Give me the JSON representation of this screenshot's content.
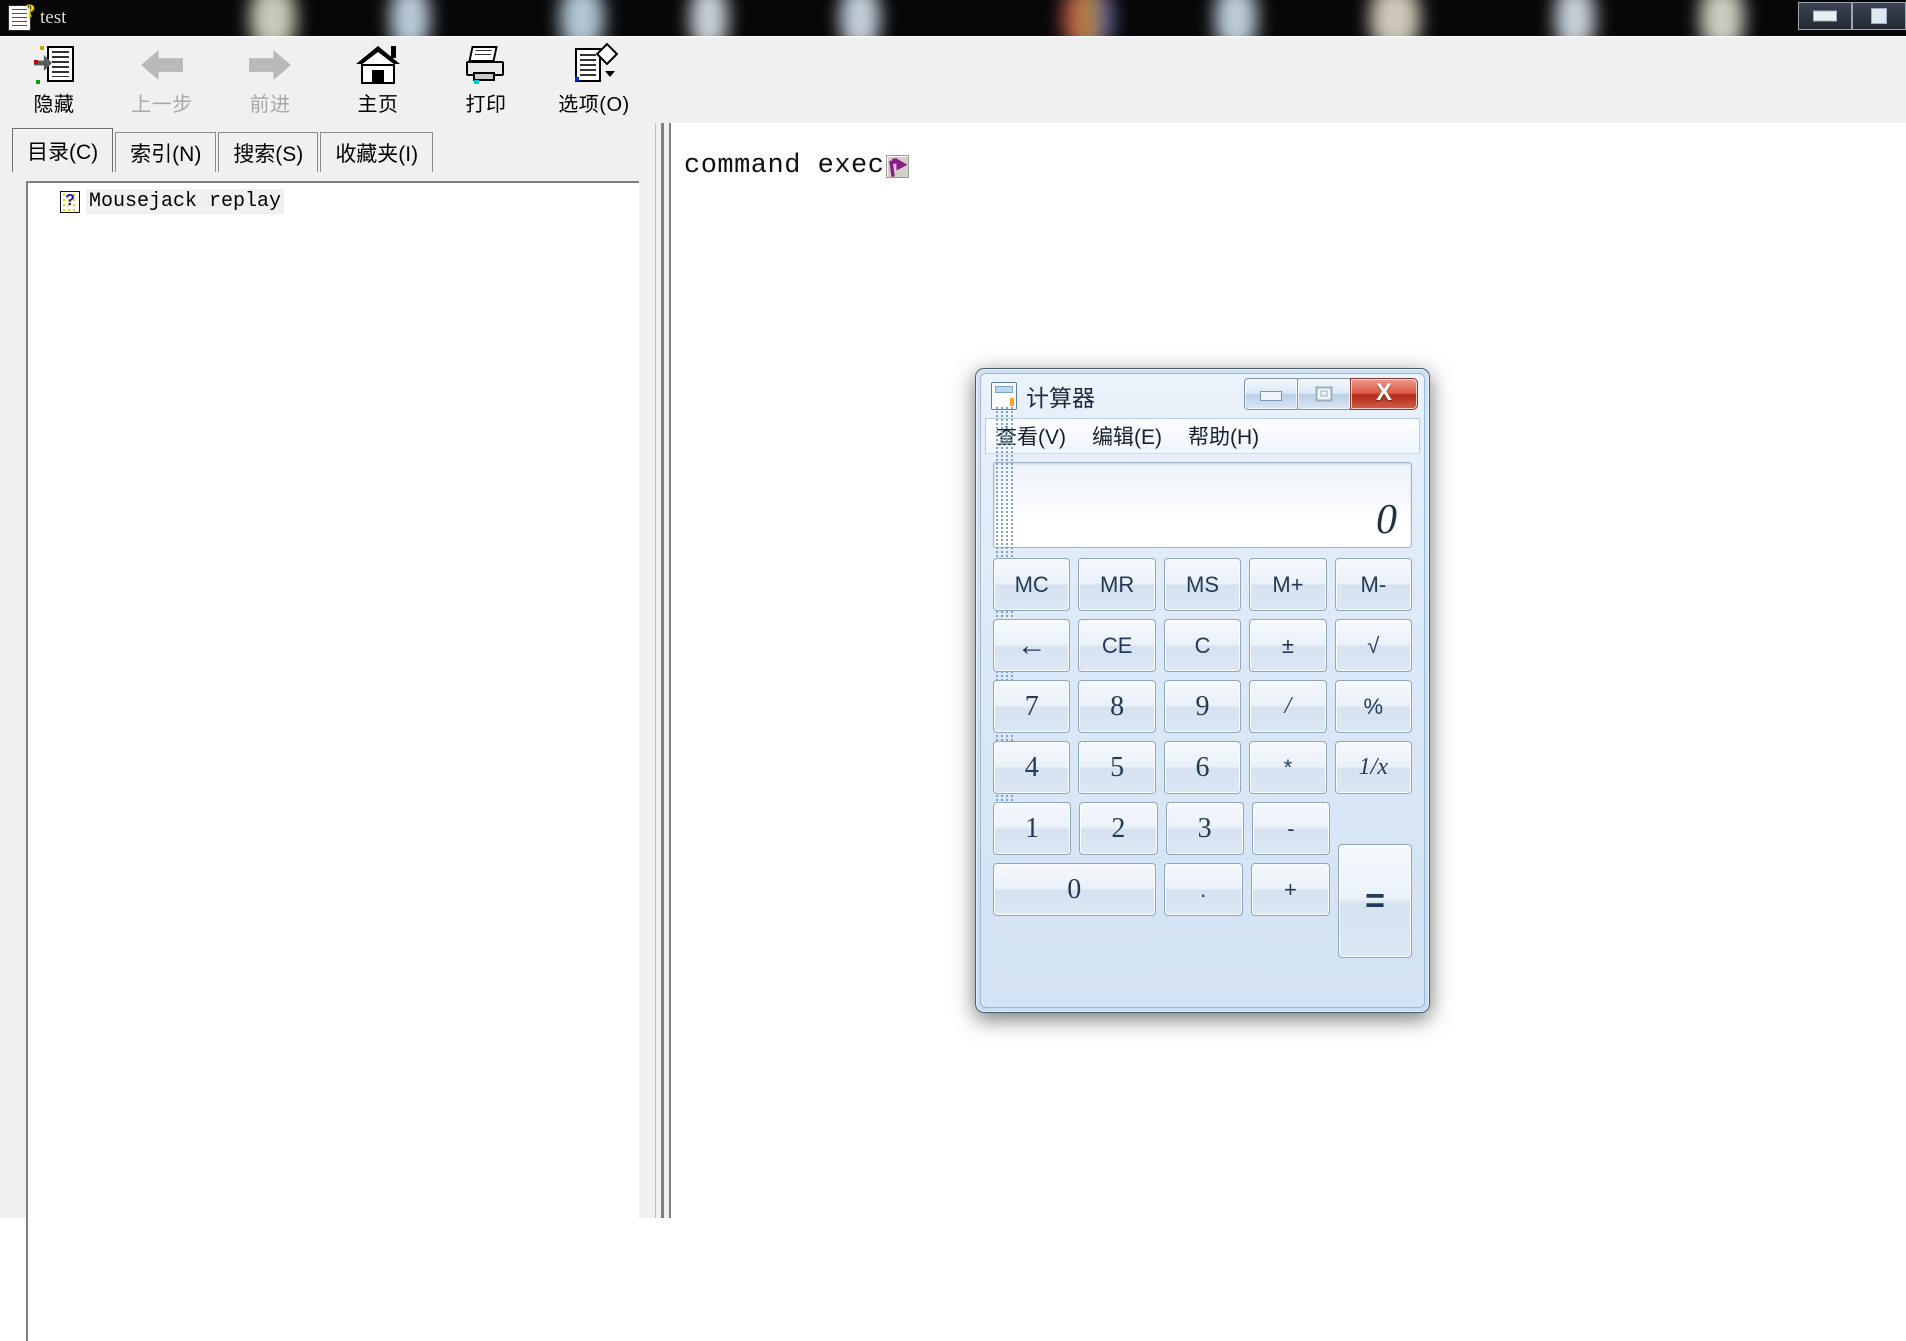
{
  "window": {
    "title": "test",
    "icon": "help-file-icon",
    "controls": [
      "minimize",
      "maximize"
    ]
  },
  "toolbar": {
    "buttons": [
      {
        "label": "隐藏",
        "icon": "hide-pane-icon",
        "disabled": false
      },
      {
        "label": "上一步",
        "icon": "back-arrow-icon",
        "disabled": true
      },
      {
        "label": "前进",
        "icon": "forward-arrow-icon",
        "disabled": true
      },
      {
        "label": "主页",
        "icon": "home-icon",
        "disabled": false
      },
      {
        "label": "打印",
        "icon": "print-icon",
        "disabled": false
      },
      {
        "label": "选项(O)",
        "icon": "options-icon",
        "disabled": false
      }
    ]
  },
  "sidebar": {
    "tabs": [
      {
        "label": "目录(C)",
        "active": true
      },
      {
        "label": "索引(N)",
        "active": false
      },
      {
        "label": "搜索(S)",
        "active": false
      },
      {
        "label": "收藏夹(I)",
        "active": false
      }
    ],
    "tree": [
      {
        "label": "Mousejack replay",
        "icon": "help-topic-icon",
        "selected": true
      }
    ]
  },
  "content": {
    "text": "command exec",
    "shortcut_icon": "shortcut-arrow-icon"
  },
  "calculator": {
    "title": "计算器",
    "icon": "calculator-icon",
    "window_controls": {
      "minimize": "minimize-icon",
      "maximize": "maximize-icon",
      "close": "X"
    },
    "menu": [
      "查看(V)",
      "编辑(E)",
      "帮助(H)"
    ],
    "display": "0",
    "rows": [
      [
        {
          "label": "MC"
        },
        {
          "label": "MR"
        },
        {
          "label": "MS"
        },
        {
          "label": "M+"
        },
        {
          "label": "M-"
        }
      ],
      [
        {
          "label": "←"
        },
        {
          "label": "CE"
        },
        {
          "label": "C"
        },
        {
          "label": "±"
        },
        {
          "label": "√"
        }
      ],
      [
        {
          "label": "7"
        },
        {
          "label": "8"
        },
        {
          "label": "9"
        },
        {
          "label": "/"
        },
        {
          "label": "%"
        }
      ],
      [
        {
          "label": "4"
        },
        {
          "label": "5"
        },
        {
          "label": "6"
        },
        {
          "label": "*"
        },
        {
          "label": "1/x"
        }
      ],
      [
        {
          "label": "1"
        },
        {
          "label": "2"
        },
        {
          "label": "3"
        },
        {
          "label": "-"
        }
      ],
      [
        {
          "label": "0"
        },
        {
          "label": "."
        },
        {
          "label": "+"
        }
      ]
    ],
    "equals": "="
  },
  "colors": {
    "toolbar_bg": "#f0f0f0",
    "content_bg": "#ffffff",
    "calc_bg": "#d6e5f5",
    "close_red": "#c2371f",
    "accent_blue": "#243a55"
  }
}
